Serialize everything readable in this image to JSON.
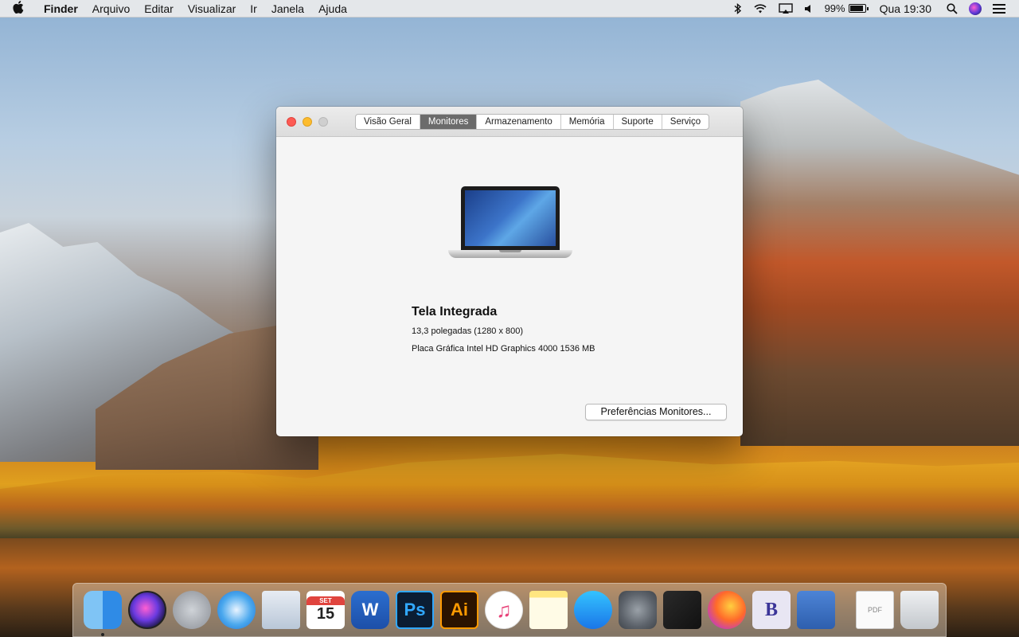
{
  "menubar": {
    "apple_icon": "apple-logo",
    "items": [
      "Finder",
      "Arquivo",
      "Editar",
      "Visualizar",
      "Ir",
      "Janela",
      "Ajuda"
    ],
    "status": {
      "icons": [
        "bluetooth-icon",
        "wifi-icon",
        "airplay-icon",
        "volume-icon"
      ],
      "battery_text": "99%",
      "battery_level": 0.99,
      "clock": "Qua 19:30",
      "trailing_icons": [
        "search-icon",
        "siri-icon",
        "control-center-icon"
      ]
    }
  },
  "window": {
    "tabs": [
      "Visão Geral",
      "Monitores",
      "Armazenamento",
      "Memória",
      "Suporte",
      "Serviço"
    ],
    "active_tab": "Monitores",
    "display": {
      "name": "Tela Integrada",
      "size": "13,3 polegadas (1280 x 800)",
      "graphics": "Placa Gráfica Intel HD Graphics 4000 1536 MB"
    },
    "pref_button": "Preferências Monitores..."
  },
  "dock": {
    "apps": [
      {
        "name": "finder-icon",
        "label": "",
        "running": true
      },
      {
        "name": "siri-icon",
        "label": ""
      },
      {
        "name": "launchpad-icon",
        "label": ""
      },
      {
        "name": "safari-icon",
        "label": ""
      },
      {
        "name": "mail-icon",
        "label": ""
      },
      {
        "name": "calendar-icon",
        "label": "15",
        "sub": "SET"
      },
      {
        "name": "word-icon",
        "label": "W"
      },
      {
        "name": "photoshop-icon",
        "label": "Ps"
      },
      {
        "name": "illustrator-icon",
        "label": "Ai"
      },
      {
        "name": "itunes-icon",
        "label": "♫"
      },
      {
        "name": "notes-icon",
        "label": ""
      },
      {
        "name": "app-store-icon",
        "label": ""
      },
      {
        "name": "system-preferences-icon",
        "label": ""
      },
      {
        "name": "final-cut-pro-icon",
        "label": ""
      },
      {
        "name": "firefox-icon",
        "label": ""
      },
      {
        "name": "bbedit-icon",
        "label": "B"
      },
      {
        "name": "transmit-icon",
        "label": ""
      }
    ],
    "trailing": [
      {
        "name": "pdf-document-icon",
        "label": "PDF"
      },
      {
        "name": "trash-icon",
        "label": ""
      }
    ]
  }
}
